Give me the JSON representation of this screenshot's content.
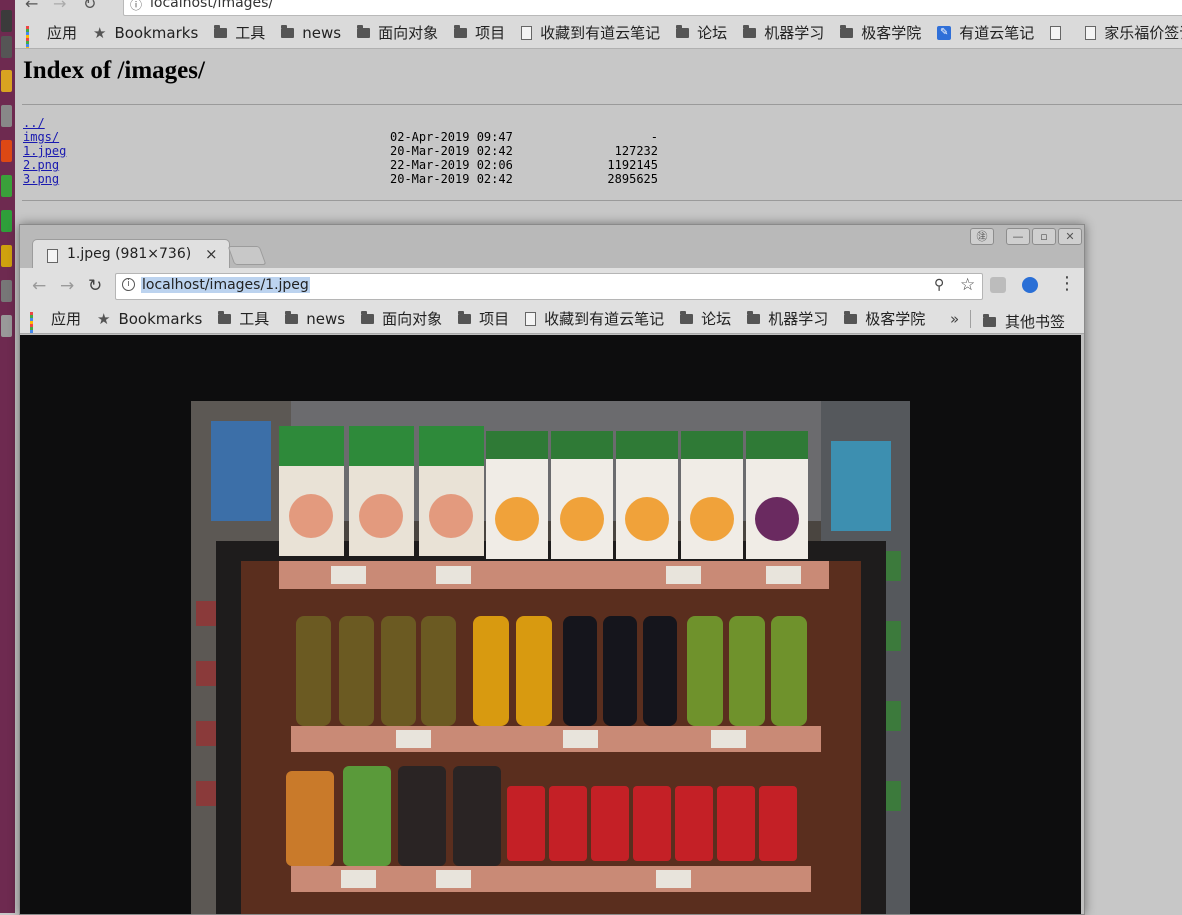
{
  "back_browser": {
    "url": "localhost/images/",
    "bookmarks": [
      {
        "label": "应用",
        "icon": "apps-icon"
      },
      {
        "label": "Bookmarks",
        "icon": "star-icon"
      },
      {
        "label": "工具",
        "icon": "folder-icon"
      },
      {
        "label": "news",
        "icon": "folder-icon"
      },
      {
        "label": "面向对象",
        "icon": "folder-icon"
      },
      {
        "label": "项目",
        "icon": "folder-icon"
      },
      {
        "label": "收藏到有道云笔记",
        "icon": "page-icon"
      },
      {
        "label": "论坛",
        "icon": "folder-icon"
      },
      {
        "label": "机器学习",
        "icon": "folder-icon"
      },
      {
        "label": "极客学院",
        "icon": "folder-icon"
      },
      {
        "label": "有道云笔记",
        "icon": "youdao-icon"
      },
      {
        "label": "",
        "icon": "page-icon"
      },
      {
        "label": "家乐福价签识别",
        "icon": "page-icon"
      }
    ]
  },
  "index_page": {
    "title": "Index of /images/",
    "entries": [
      {
        "name": "../",
        "date": "",
        "size": ""
      },
      {
        "name": "imgs/",
        "date": "02-Apr-2019 09:47",
        "size": "-"
      },
      {
        "name": "1.jpeg",
        "date": "20-Mar-2019 02:42",
        "size": "127232"
      },
      {
        "name": "2.png",
        "date": "22-Mar-2019 02:06",
        "size": "1192145"
      },
      {
        "name": "3.png",
        "date": "20-Mar-2019 02:42",
        "size": "2895625"
      }
    ]
  },
  "foreground_window": {
    "tab_title": "1.jpeg (981×736)",
    "tab_close": "×",
    "url": "localhost/images/1.jpeg",
    "bookmarks": [
      {
        "label": "应用",
        "icon": "apps-icon"
      },
      {
        "label": "Bookmarks",
        "icon": "star-icon"
      },
      {
        "label": "工具",
        "icon": "folder-icon"
      },
      {
        "label": "news",
        "icon": "folder-icon"
      },
      {
        "label": "面向对象",
        "icon": "folder-icon"
      },
      {
        "label": "项目",
        "icon": "folder-icon"
      },
      {
        "label": "收藏到有道云笔记",
        "icon": "page-icon"
      },
      {
        "label": "论坛",
        "icon": "folder-icon"
      },
      {
        "label": "机器学习",
        "icon": "folder-icon"
      },
      {
        "label": "极客学院",
        "icon": "folder-icon"
      }
    ],
    "overflow_label": "»",
    "other_bookmarks": "其他书签"
  },
  "colors": {
    "launcher": "#6e2a50",
    "link": "#1a1ab0",
    "viewer_bg": "#0d0d0e",
    "url_highlight": "#bcd3ef"
  }
}
